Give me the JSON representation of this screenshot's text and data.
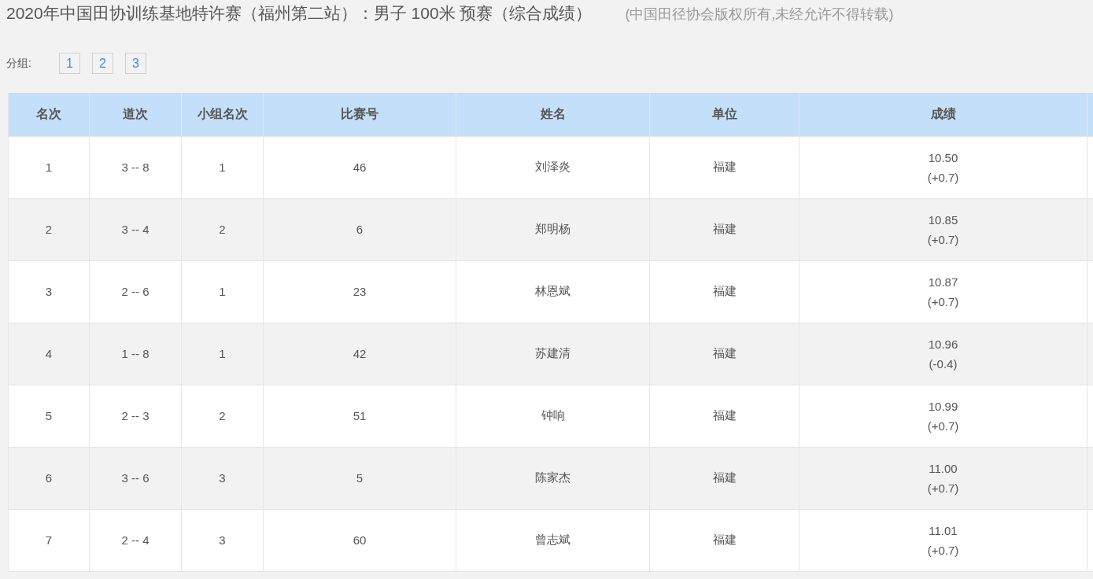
{
  "page_title": "2020年中国田协训练基地特许赛（福州第二站）：男子 100米 预赛（综合成绩）",
  "copyright_note": "(中国田径协会版权所有,未经允许不得转载)",
  "groups": {
    "label": "分组:",
    "items": [
      "1",
      "2",
      "3"
    ]
  },
  "table": {
    "columns": [
      "名次",
      "道次",
      "小组名次",
      "比赛号",
      "姓名",
      "单位",
      "成绩"
    ],
    "rows": [
      {
        "rank": "1",
        "lane": "3 -- 8",
        "group_rank": "1",
        "bib": "46",
        "name": "刘泽炎",
        "team": "福建",
        "time": "10.50",
        "wind": "(+0.7)"
      },
      {
        "rank": "2",
        "lane": "3 -- 4",
        "group_rank": "2",
        "bib": "6",
        "name": "郑明杨",
        "team": "福建",
        "time": "10.85",
        "wind": "(+0.7)"
      },
      {
        "rank": "3",
        "lane": "2 -- 6",
        "group_rank": "1",
        "bib": "23",
        "name": "林恩斌",
        "team": "福建",
        "time": "10.87",
        "wind": "(+0.7)"
      },
      {
        "rank": "4",
        "lane": "1 -- 8",
        "group_rank": "1",
        "bib": "42",
        "name": "苏建清",
        "team": "福建",
        "time": "10.96",
        "wind": "(-0.4)"
      },
      {
        "rank": "5",
        "lane": "2 -- 3",
        "group_rank": "2",
        "bib": "51",
        "name": "钟响",
        "team": "福建",
        "time": "10.99",
        "wind": "(+0.7)"
      },
      {
        "rank": "6",
        "lane": "3 -- 6",
        "group_rank": "3",
        "bib": "5",
        "name": "陈家杰",
        "team": "福建",
        "time": "11.00",
        "wind": "(+0.7)"
      },
      {
        "rank": "7",
        "lane": "2 -- 4",
        "group_rank": "3",
        "bib": "60",
        "name": "曾志斌",
        "team": "福建",
        "time": "11.01",
        "wind": "(+0.7)"
      }
    ]
  }
}
